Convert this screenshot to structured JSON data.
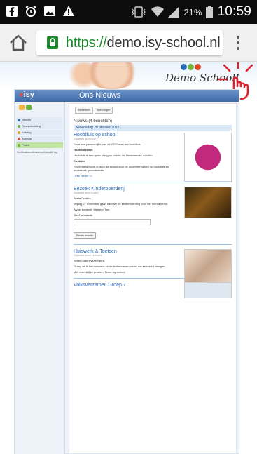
{
  "status_bar": {
    "battery_percent": "21%",
    "time": "10:59"
  },
  "browser": {
    "url_scheme": "https://",
    "url_host": "demo.isy-school.nl"
  },
  "site": {
    "logo": "isy",
    "page_title": "Ons Nieuws",
    "banner_text": "Demo School!",
    "toolbar_buttons": [
      "Bewerken",
      "toevoegen"
    ],
    "sidebar_items": [
      {
        "label": "Nieuws",
        "color": "#2a6ab3"
      },
      {
        "label": "Groepsindeling",
        "color": "#6fb13a"
      },
      {
        "label": "Katalog",
        "color": "#e2a11c"
      },
      {
        "label": "Agenda",
        "color": "#d9472b"
      },
      {
        "label": "Profiel",
        "color": "#6fb13a"
      }
    ],
    "sidebar_note": "Verificatiecode/aanmelden bij Isy",
    "news_header": "Nieuws (4 berichten)",
    "date_header": "Woensdag 28 oktober 2015",
    "articles": [
      {
        "title": "Hoofdluis op school",
        "meta": "Geplaatst door GGD",
        "paragraphs": [
          "Deze een persoonlijke van de GGD over het hoofdluis.",
          "Hoofdluiswerk",
          "Hoofdluis is een grote plaag op nature die Nederlandse scholen.",
          "Controle",
          "Regelmatig wordt er door de school door de ouderwerkgroep op hoofdluis en onderzoek gecontroleerd."
        ],
        "more": "Lees verder >>"
      },
      {
        "title": "Bezoek Kinderboerderij",
        "meta": "Geplaatst door Ouders",
        "paragraphs": [
          "Beste Ouders,",
          "Vrijdag 27 november gaan we naar de kinderboerderij voor het thema herfst.",
          "Alvast bedankt, Meester Tom"
        ],
        "reply_label": "Geef je reactie",
        "reply_button": "Plaats reactie"
      },
      {
        "title": "Huiswerk & Toetsen",
        "meta": "Geplaatst door Leerkracht",
        "paragraphs": [
          "Beste ouders/verzorgers,",
          "Graag wil ik het huiswerk en de toetsen even onder uw aandacht brengen.",
          "Met vriendelijke groeten, Team Isy-school"
        ]
      },
      {
        "title": "Volksverzamen Groep 7",
        "meta": "",
        "paragraphs": []
      }
    ]
  },
  "colors": {
    "status_bar_bg": "#0c0c0c",
    "url_secure_green": "#1a8a2a",
    "site_header_blue": "#3d6aa8",
    "link_blue": "#2a6ab3"
  }
}
